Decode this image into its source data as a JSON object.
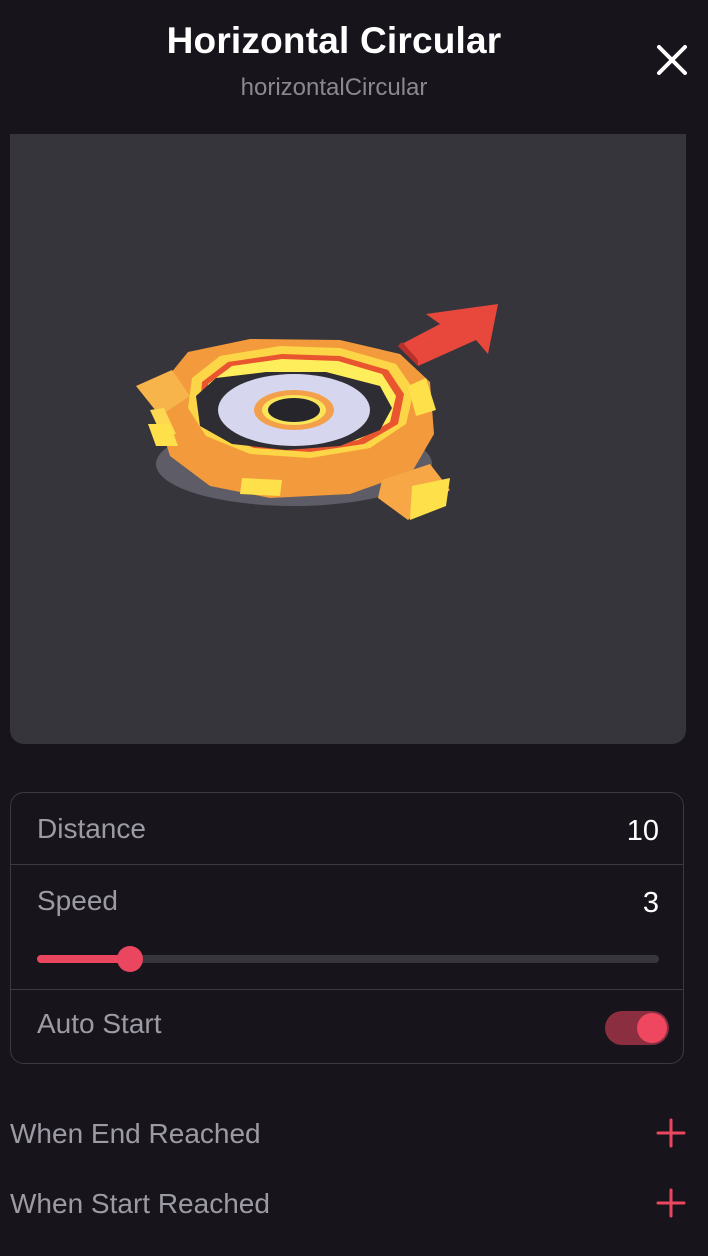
{
  "header": {
    "title": "Horizontal Circular",
    "subtitle": "horizontalCircular",
    "close_icon": "close-icon"
  },
  "preview": {
    "background": "#36353c",
    "model": "orange circular platform with red direction arrow"
  },
  "properties": {
    "distance": {
      "label": "Distance",
      "value": "10"
    },
    "speed": {
      "label": "Speed",
      "value": "3",
      "slider_fraction": 0.15
    },
    "auto_start": {
      "label": "Auto Start",
      "enabled": true
    }
  },
  "events": [
    {
      "label": "When End Reached",
      "icon": "plus-icon"
    },
    {
      "label": "When Start Reached",
      "icon": "plus-icon"
    }
  ],
  "colors": {
    "accent": "#eb4660",
    "background": "#17151b",
    "panel": "#36353c",
    "label": "#9c9aa3"
  }
}
